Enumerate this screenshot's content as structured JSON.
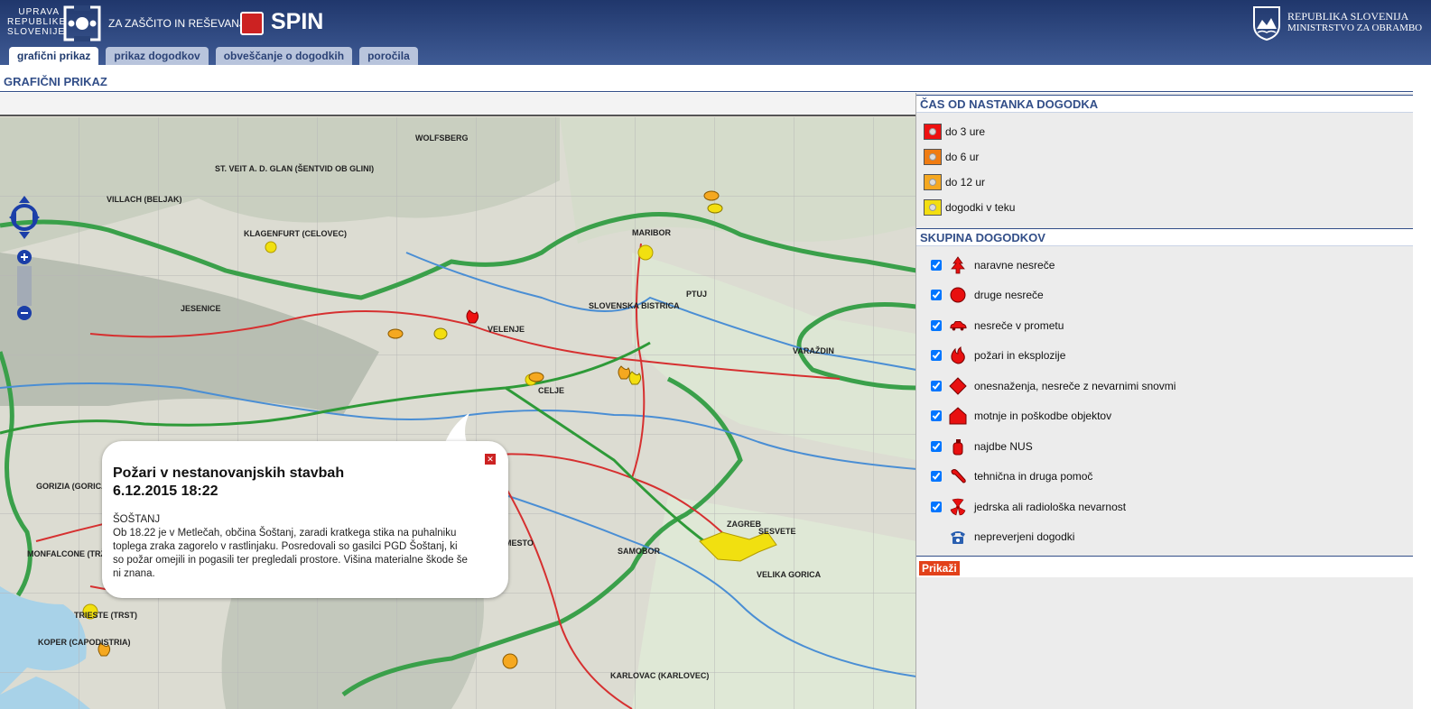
{
  "header": {
    "agency_lines": [
      "UPRAVA",
      "REPUBLIKE",
      "SLOVENIJE"
    ],
    "agency_sub": "ZA ZAŠČITO IN REŠEVANJE",
    "app_name": "SPIN",
    "ministry_line1": "REPUBLIKA SLOVENIJA",
    "ministry_line2": "MINISTRSTVO ZA OBRAMBO"
  },
  "tabs": [
    {
      "label": "grafični prikaz",
      "active": true
    },
    {
      "label": "prikaz dogodkov",
      "active": false
    },
    {
      "label": "obveščanje o dogodkih",
      "active": false
    },
    {
      "label": "poročila",
      "active": false
    }
  ],
  "page_title": "GRAFIČNI PRIKAZ",
  "map": {
    "place_labels": [
      "VILLACH (BELJAK)",
      "KLAGENFURT (CELOVEC)",
      "MARIBOR",
      "CELJE",
      "VELENJE",
      "PTUJ",
      "ZAGREB",
      "TRIESTE (TRST)",
      "KOPER (CAPODISTRIA)",
      "NOVO MESTO",
      "VARAŽDIN",
      "KARLOVAC (KARLOVEC)",
      "JESENICE",
      "GORIZIA (GORICA)",
      "MONFALCONE (TRŽIČ)",
      "SAMOBOR",
      "VELIKA GORICA",
      "ST. VEIT A. D. GLAN (ŠENTVID OB GLINI)",
      "WOLFSBERG",
      "SLOVENSKA BISTRICA",
      "SESVETE"
    ],
    "popup": {
      "title_line1": "Požari v nestanovanjskih stavbah",
      "title_line2": "6.12.2015 18:22",
      "location": "ŠOŠTANJ",
      "text": "Ob 18.22 je v Metlečah, občina Šoštanj, zaradi kratkega stika na puhalniku toplega zraka zagorelo v rastlinjaku. Posredovali so gasilci PGD Šoštanj, ki so požar omejili in pogasili ter pregledali prostore. Višina materialne škode še ni znana."
    }
  },
  "time_legend": {
    "title": "ČAS OD NASTANKA DOGODKA",
    "items": [
      {
        "label": "do 3 ure",
        "color": "#ee1111"
      },
      {
        "label": "do 6 ur",
        "color": "#f07c12"
      },
      {
        "label": "do 12 ur",
        "color": "#f5a820"
      },
      {
        "label": "dogodki v teku",
        "color": "#f3de10"
      }
    ]
  },
  "group_legend": {
    "title": "SKUPINA DOGODKOV",
    "items": [
      {
        "label": "naravne nesreče",
        "icon": "tree-icon",
        "checked": true
      },
      {
        "label": "druge nesreče",
        "icon": "circle-icon",
        "checked": true
      },
      {
        "label": "nesreče v prometu",
        "icon": "car-icon",
        "checked": true
      },
      {
        "label": "požari in eksplozije",
        "icon": "fire-icon",
        "checked": true
      },
      {
        "label": "onesnaženja, nesreče z nevarnimi snovmi",
        "icon": "diamond-icon",
        "checked": true
      },
      {
        "label": "motnje in poškodbe objektov",
        "icon": "house-icon",
        "checked": true
      },
      {
        "label": "najdbe NUS",
        "icon": "grenade-icon",
        "checked": true
      },
      {
        "label": "tehnična in druga pomoč",
        "icon": "wrench-icon",
        "checked": true
      },
      {
        "label": "jedrska ali radiološka nevarnost",
        "icon": "radiation-icon",
        "checked": true
      },
      {
        "label": "nepreverjeni dogodki",
        "icon": "phone-icon",
        "checked": false
      }
    ]
  },
  "show_button": "Prikaži",
  "colors": {
    "header_dark": "#20376c",
    "accent_blue": "#324e88",
    "button_red": "#e2411a"
  }
}
